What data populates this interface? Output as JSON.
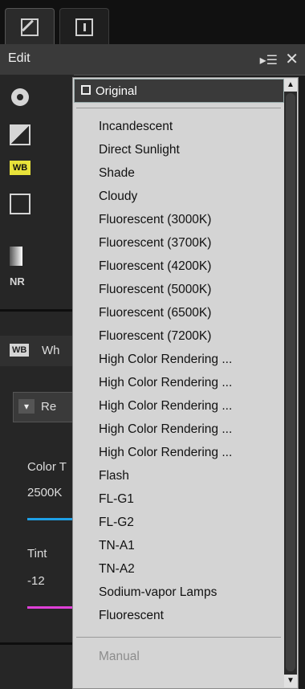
{
  "header": {
    "title": "Edit",
    "menu_icon": "▸☰",
    "close_icon": "✕"
  },
  "tabs": [
    {
      "name": "edit-tab",
      "icon": "edit-icon"
    },
    {
      "name": "info-tab",
      "icon": "info-icon"
    }
  ],
  "toolbar": {
    "wb_badge": "WB",
    "nr_label": "NR",
    "wb_section_title": "Wh",
    "dropdown_label": "Re",
    "color_temp_label": "Color T",
    "color_temp_value": "2500K",
    "tint_label": "Tint",
    "tint_value": "-12",
    "accent_blue": "#1ea0e6",
    "accent_magenta": "#e040d8"
  },
  "popup": {
    "selected": "Original",
    "items": [
      "Incandescent",
      "Direct Sunlight",
      "Shade",
      "Cloudy",
      "Fluorescent (3000K)",
      "Fluorescent (3700K)",
      "Fluorescent (4200K)",
      "Fluorescent (5000K)",
      "Fluorescent (6500K)",
      "Fluorescent (7200K)",
      "High Color Rendering ...",
      "High Color Rendering ...",
      "High Color Rendering ...",
      "High Color Rendering ...",
      "High Color Rendering ...",
      "Flash",
      "FL-G1",
      "FL-G2",
      "TN-A1",
      "TN-A2",
      "Sodium-vapor Lamps",
      "Fluorescent"
    ],
    "disabled_item": "Manual"
  }
}
